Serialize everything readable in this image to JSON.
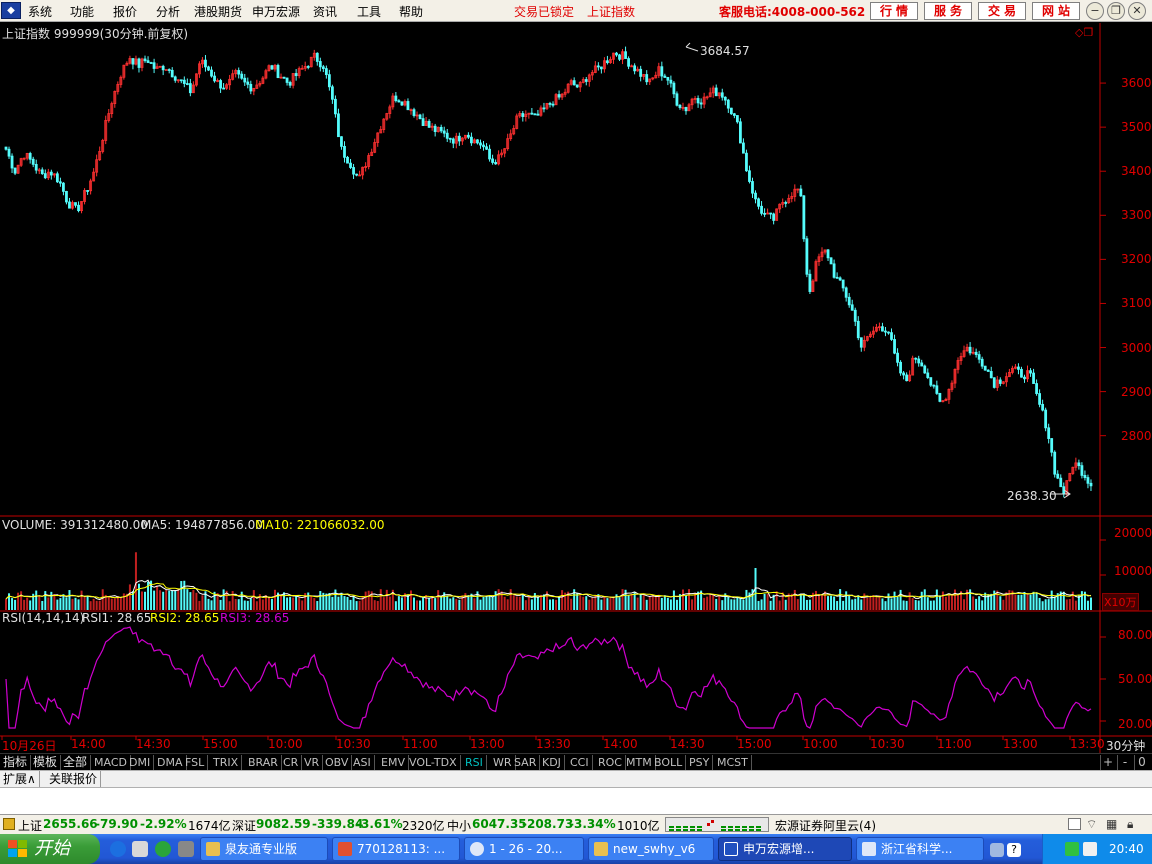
{
  "menubar": {
    "logo_glyph": "◆",
    "menus": [
      "系统",
      "功能",
      "报价",
      "分析",
      "港股期货",
      "申万宏源",
      "资讯",
      "工具",
      "帮助"
    ],
    "status_locked": "交易已锁定",
    "status_index": "上证指数",
    "hotline": "客服电话:4008-000-562",
    "nav_buttons": [
      "行情",
      "服务",
      "交易",
      "网站"
    ]
  },
  "chart": {
    "title": "上证指数 999999(30分钟.前复权)",
    "high_label": "3684.57",
    "low_label": "2638.30",
    "price_ticks": [
      "3600",
      "3500",
      "3400",
      "3300",
      "3200",
      "3100",
      "3000",
      "2900",
      "2800"
    ],
    "volume": {
      "label": "VOLUME: 391312480.00",
      "ma5": "MA5: 194877856.00",
      "ma10": "MA10: 221066032.00",
      "ticks": [
        "20000",
        "10000"
      ],
      "unit": "X10万"
    },
    "rsi": {
      "label": "RSI(14,14,14)",
      "rsi1": "RSI1: 28.65",
      "rsi2": "RSI2: 28.65",
      "rsi3": "RSI3: 28.65",
      "ticks": [
        "80.00",
        "50.00",
        "20.00"
      ]
    },
    "time_axis": [
      "10月26日",
      "14:00",
      "14:30",
      "15:00",
      "10:00",
      "10:30",
      "11:00",
      "13:00",
      "13:30",
      "14:00",
      "14:30",
      "15:00",
      "10:00",
      "10:30",
      "11:00",
      "13:00",
      "13:30"
    ],
    "period": "30分钟"
  },
  "chart_data": {
    "type": "candlestick",
    "instrument": "上证指数 999999",
    "interval": "30分钟",
    "price_range": [
      2638.3,
      3684.57
    ],
    "high": 3684.57,
    "low": 2638.3,
    "close_path": [
      3450,
      3400,
      3440,
      3420,
      3390,
      3400,
      3380,
      3330,
      3310,
      3350,
      3400,
      3480,
      3560,
      3620,
      3660,
      3640,
      3655,
      3630,
      3640,
      3620,
      3600,
      3580,
      3650,
      3630,
      3600,
      3590,
      3620,
      3600,
      3590,
      3610,
      3640,
      3620,
      3600,
      3620,
      3640,
      3660,
      3640,
      3560,
      3450,
      3420,
      3380,
      3430,
      3480,
      3530,
      3570,
      3560,
      3540,
      3520,
      3500,
      3490,
      3480,
      3470,
      3490,
      3470,
      3460,
      3420,
      3430,
      3470,
      3520,
      3530,
      3520,
      3540,
      3560,
      3570,
      3600,
      3590,
      3620,
      3630,
      3650,
      3670,
      3660,
      3640,
      3620,
      3600,
      3630,
      3610,
      3560,
      3540,
      3570,
      3560,
      3580,
      3580,
      3550,
      3500,
      3400,
      3330,
      3300,
      3290,
      3330,
      3350,
      3360,
      3120,
      3200,
      3220,
      3160,
      3130,
      3080,
      3000,
      3030,
      3050,
      3040,
      2960,
      2920,
      2980,
      2960,
      2910,
      2870,
      2910,
      2980,
      3000,
      2980,
      2960,
      2920,
      2930,
      2950,
      2940,
      2940,
      2880,
      2820,
      2710,
      2670,
      2740,
      2720,
      2690
    ],
    "volume": {
      "value": 391312480.0,
      "ma5": 194877856.0,
      "ma10": 221066032.0,
      "unit": "X10万",
      "axis_ticks": [
        10000,
        20000
      ]
    },
    "rsi": {
      "params": [
        14,
        14,
        14
      ],
      "rsi1": 28.65,
      "rsi2": 28.65,
      "rsi3": 28.65,
      "axis_ticks": [
        20,
        50,
        80
      ]
    },
    "colors": {
      "up": "#ff3030",
      "down": "#54fcfc",
      "ma5": "#ffffff",
      "ma10": "#ffff00",
      "rsi": "#d000d0",
      "axis": "#c00000"
    }
  },
  "tabs": {
    "left": [
      "指标",
      "模板",
      "全部"
    ],
    "indicators": [
      "MACD",
      "DMI",
      "DMA",
      "FSL",
      "TRIX",
      "BRAR",
      "CR",
      "VR",
      "OBV",
      "ASI",
      "EMV",
      "VOL-TDX",
      "RSI",
      "WR",
      "SAR",
      "KDJ",
      "CCI",
      "ROC",
      "MTM",
      "BOLL",
      "PSY",
      "MCST"
    ],
    "active": "RSI",
    "controls": [
      "+",
      "-",
      "0"
    ]
  },
  "expand": {
    "buttons": [
      "扩展∧",
      "关联报价"
    ]
  },
  "statusbar": {
    "sh_name": "上证",
    "sh_value": "2655.66",
    "sh_change": "-79.90",
    "sh_pct": "-2.92%",
    "sh_amount": "1674亿",
    "sz_name": "深证",
    "sz_value": "9082.59",
    "sz_change": "-339.84",
    "sz_pct": "-3.61%",
    "sz_amount": "2320亿",
    "zx_name": "中小",
    "zx_value": "6047.35",
    "zx_change": "-208.73",
    "zx_pct": "-3.34%",
    "zx_amount": "1010亿",
    "server": "宏源证券阿里云(4)"
  },
  "taskbar": {
    "start": "开始",
    "tasks": [
      "泉友通专业版",
      "770128113: ...",
      "1 - 26 - 20...",
      "new_swhy_v6",
      "申万宏源增...",
      "浙江省科学..."
    ],
    "active_task": "申万宏源增...",
    "clock": "20:40"
  }
}
